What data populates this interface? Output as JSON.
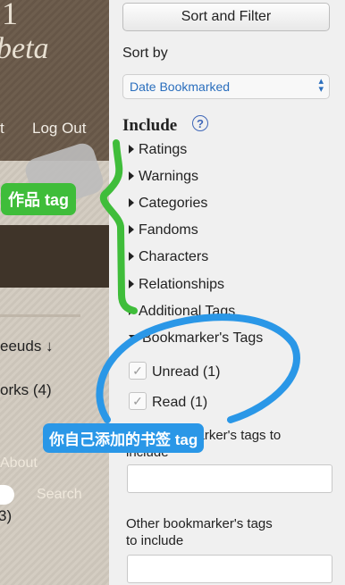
{
  "site": {
    "logo_top": "1",
    "logo_bottom": "beta",
    "nav_partial": "t",
    "logout": "Log Out",
    "about": "About",
    "search": "Search",
    "list_items": [
      "eeuds ↓",
      "orks (4)",
      "3)"
    ]
  },
  "filter_panel": {
    "sort_filter_button": "Sort and Filter",
    "sort_by_label": "Sort by",
    "sort_by_value": "Date Bookmarked",
    "include_heading": "Include",
    "help_symbol": "?",
    "categories": [
      "Ratings",
      "Warnings",
      "Categories",
      "Fandoms",
      "Characters",
      "Relationships",
      "Additional Tags"
    ],
    "bookmarker_tags_heading": "Bookmarker's Tags",
    "bookmarker_tags": [
      {
        "label": "Unread (1)",
        "checked": true
      },
      {
        "label": "Read (1)",
        "checked": true
      }
    ],
    "your_tags_label_line1": "Your bookmarker's tags to",
    "your_tags_label_line2": "include",
    "other_tags_label_line1": "Other bookmarker's tags",
    "other_tags_label_line2": "to include",
    "check_symbol": "✓"
  },
  "annotations": {
    "green_label": "作品 tag",
    "blue_label": "你自己添加的书签 tag",
    "green_color": "#3fbd3a",
    "blue_color": "#2a97e7"
  },
  "colors": {
    "link_blue": "#2a6ebd",
    "panel_bg": "#f0f0f0",
    "header_brown": "#6e5e4e"
  }
}
